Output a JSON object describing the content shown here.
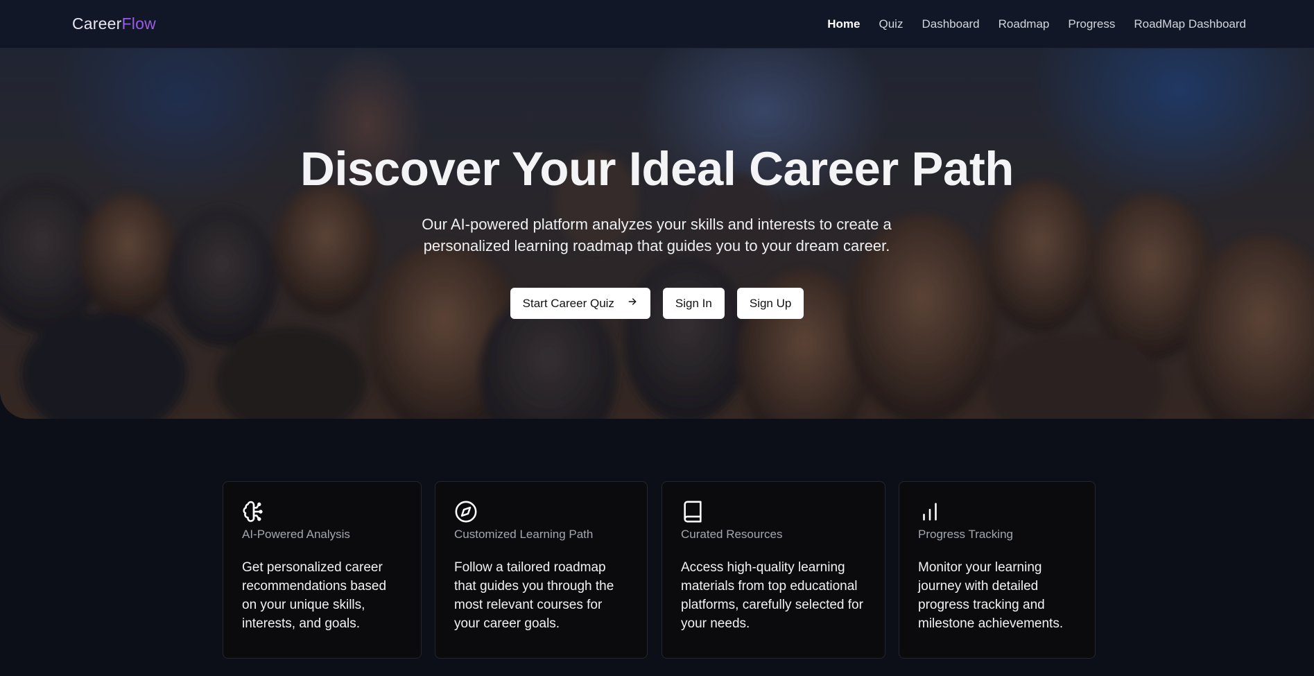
{
  "nav": {
    "brand_part1": "Career",
    "brand_part2": "Flow",
    "links": [
      {
        "label": "Home",
        "active": true
      },
      {
        "label": "Quiz"
      },
      {
        "label": "Dashboard"
      },
      {
        "label": "Roadmap"
      },
      {
        "label": "Progress"
      },
      {
        "label": "RoadMap Dashboard"
      }
    ]
  },
  "hero": {
    "title": "Discover Your Ideal Career Path",
    "subtitle": "Our AI-powered platform analyzes your skills and interests to create a personalized learning roadmap that guides you to your dream career.",
    "buttons": {
      "quiz": "Start Career Quiz",
      "signin": "Sign In",
      "signup": "Sign Up"
    }
  },
  "features": [
    {
      "icon": "brain-icon",
      "title": "AI-Powered Analysis",
      "desc": "Get personalized career recommendations based on your unique skills, interests, and goals."
    },
    {
      "icon": "compass-icon",
      "title": "Customized Learning Path",
      "desc": "Follow a tailored roadmap that guides you through the most relevant courses for your career goals."
    },
    {
      "icon": "book-icon",
      "title": "Curated Resources",
      "desc": "Access high-quality learning materials from top educational platforms, carefully selected for your needs."
    },
    {
      "icon": "bar-chart-icon",
      "title": "Progress Tracking",
      "desc": "Monitor your learning journey with detailed progress tracking and milestone achievements."
    }
  ],
  "colors": {
    "background": "#0c0f18",
    "navbar": "#111726",
    "brand_accent": "#9b5de5",
    "card_bg": "#0b0b0d"
  }
}
